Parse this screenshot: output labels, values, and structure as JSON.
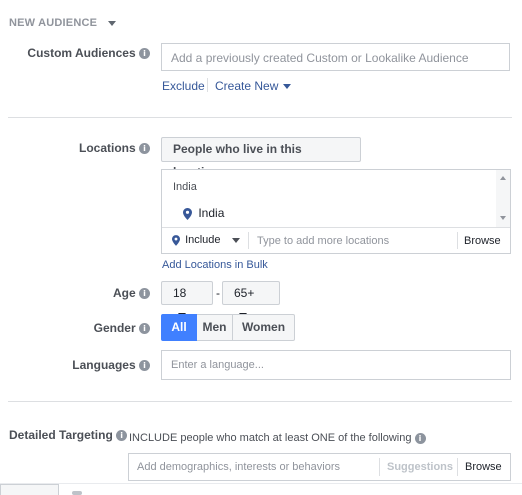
{
  "header": {
    "title": "NEW AUDIENCE"
  },
  "custom_audiences": {
    "label": "Custom Audiences",
    "placeholder": "Add a previously created Custom or Lookalike Audience",
    "exclude_link": "Exclude",
    "create_new_link": "Create New"
  },
  "locations": {
    "label": "Locations",
    "type_dropdown": "People who live in this location",
    "country_group": "India",
    "selected_location": "India",
    "include_dropdown": "Include",
    "search_placeholder": "Type to add more locations",
    "browse_label": "Browse",
    "bulk_link": "Add Locations in Bulk"
  },
  "age": {
    "label": "Age",
    "min": "18",
    "separator": "-",
    "max": "65+"
  },
  "gender": {
    "label": "Gender",
    "options": [
      "All",
      "Men",
      "Women"
    ],
    "selected": "All"
  },
  "languages": {
    "label": "Languages",
    "placeholder": "Enter a language..."
  },
  "detailed_targeting": {
    "label": "Detailed Targeting",
    "description": "INCLUDE people who match at least ONE of the following",
    "placeholder": "Add demographics, interests or behaviors",
    "suggestions_label": "Suggestions",
    "browse_label": "Browse"
  },
  "colors": {
    "accent": "#4080ff",
    "link": "#365899",
    "label": "#4b4f56",
    "border": "#ccd0d5"
  }
}
